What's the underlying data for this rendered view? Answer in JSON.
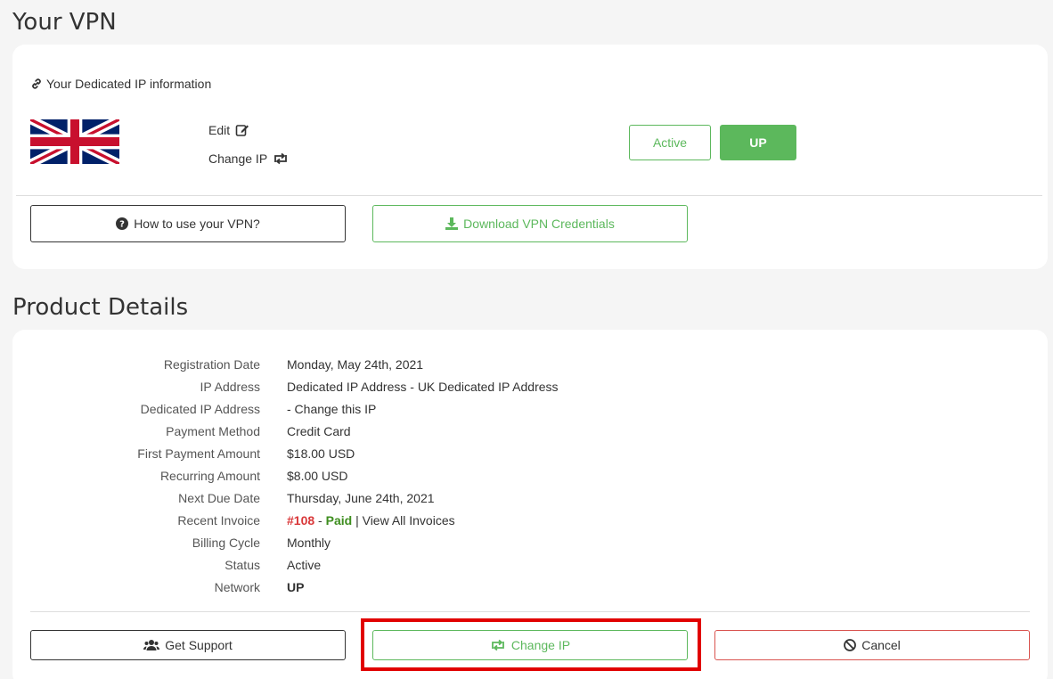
{
  "vpn_section": {
    "title": "Your VPN",
    "ip_info_label": "Your Dedicated IP information",
    "edit_label": "Edit",
    "change_ip_label": "Change IP",
    "status_active": "Active",
    "status_up": "UP",
    "how_to_button": "How to use your VPN?",
    "download_button": "Download VPN Credentials"
  },
  "product_details": {
    "title": "Product Details",
    "rows": [
      {
        "label": "Registration Date",
        "value": "Monday, May 24th, 2021"
      },
      {
        "label": "IP Address",
        "value": "Dedicated IP Address - UK Dedicated IP Address"
      },
      {
        "label": "Dedicated IP Address",
        "value": "- Change this IP"
      },
      {
        "label": "Payment Method",
        "value": "Credit Card"
      },
      {
        "label": "First Payment Amount",
        "value": "$18.00 USD"
      },
      {
        "label": "Recurring Amount",
        "value": "$8.00 USD"
      },
      {
        "label": "Next Due Date",
        "value": "Thursday, June 24th, 2021"
      },
      {
        "label": "Recent Invoice",
        "invoice_number": "#108",
        "separator": " - ",
        "invoice_status": "Paid",
        "view_all": " | View All Invoices"
      },
      {
        "label": "Billing Cycle",
        "value": "Monthly"
      },
      {
        "label": "Status",
        "value": "Active"
      },
      {
        "label": "Network",
        "value": "UP"
      }
    ],
    "buttons": {
      "support": "Get Support",
      "change_ip": "Change IP",
      "cancel": "Cancel"
    }
  },
  "colors": {
    "accent_green": "#5cb85c",
    "invoice_red": "#d9383a",
    "paid_green": "#3e8e1f",
    "highlight_red": "#e10000"
  }
}
